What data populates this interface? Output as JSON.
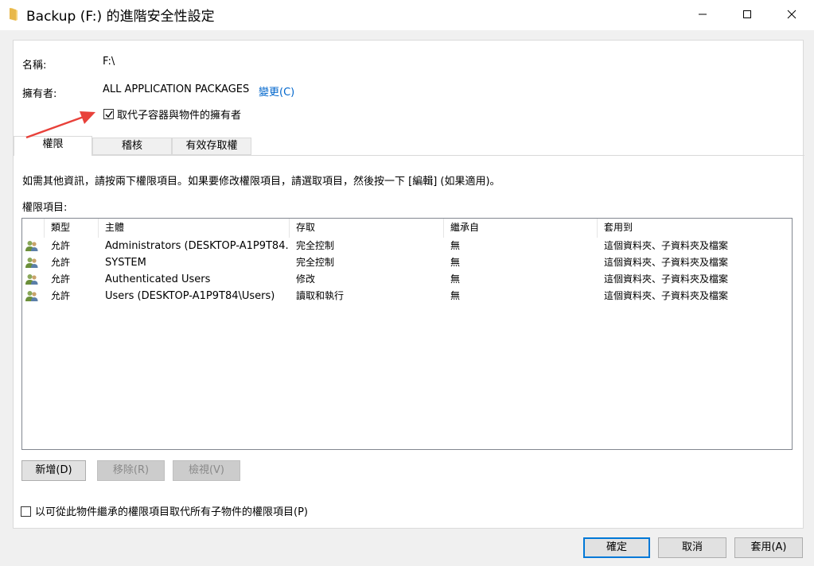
{
  "window": {
    "title": "Backup (F:) 的進階安全性設定",
    "icon": "folder-icon",
    "controls": [
      "minimize-icon",
      "maximize-icon",
      "close-icon"
    ]
  },
  "name_label": "名稱:",
  "name_value": "F:\\",
  "owner_label": "擁有者:",
  "owner_value": "ALL APPLICATION PACKAGES",
  "owner_change_link": "變更(C)",
  "replace_owner_checkbox": {
    "label": "取代子容器與物件的擁有者",
    "checked": true
  },
  "tabs": [
    {
      "label": "權限",
      "active": true
    },
    {
      "label": "稽核",
      "active": false
    },
    {
      "label": "有效存取權",
      "active": false
    }
  ],
  "info_text": "如需其他資訊，請按兩下權限項目。如果要修改權限項目，請選取項目，然後按一下 [編輯] (如果適用)。",
  "permission_entries_label": "權限項目:",
  "table": {
    "columns": [
      "類型",
      "主體",
      "存取",
      "繼承自",
      "套用到"
    ],
    "rows": [
      {
        "icon": "users-icon",
        "type": "允許",
        "principal": "Administrators (DESKTOP-A1P9T84...",
        "access": "完全控制",
        "inherited": "無",
        "applies": "這個資料夾、子資料夾及檔案"
      },
      {
        "icon": "users-icon",
        "type": "允許",
        "principal": "SYSTEM",
        "access": "完全控制",
        "inherited": "無",
        "applies": "這個資料夾、子資料夾及檔案"
      },
      {
        "icon": "users-icon",
        "type": "允許",
        "principal": "Authenticated Users",
        "access": "修改",
        "inherited": "無",
        "applies": "這個資料夾、子資料夾及檔案"
      },
      {
        "icon": "users-icon",
        "type": "允許",
        "principal": "Users (DESKTOP-A1P9T84\\Users)",
        "access": "讀取和執行",
        "inherited": "無",
        "applies": "這個資料夾、子資料夾及檔案"
      }
    ]
  },
  "buttons": {
    "add": "新增(D)",
    "remove": "移除(R)",
    "view": "檢視(V)"
  },
  "replace_child_checkbox": {
    "label": "以可從此物件繼承的權限項目取代所有子物件的權限項目(P)",
    "checked": false
  },
  "footer": {
    "ok": "確定",
    "cancel": "取消",
    "apply": "套用(A)"
  },
  "colors": {
    "accent": "#0078d7",
    "annotation_arrow": "#e8413a",
    "link": "#0066cc"
  }
}
